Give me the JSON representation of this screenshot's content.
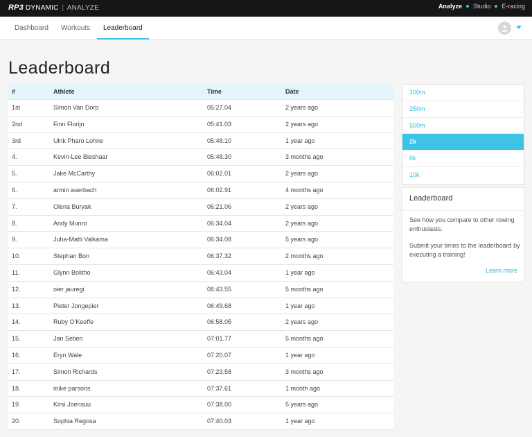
{
  "topbar": {
    "brand_logo": "RP3",
    "brand_name": "DYNAMIC",
    "brand_sep": "|",
    "brand_sub": "ANALYZE",
    "apps": [
      {
        "label": "Analyze",
        "active": true
      },
      {
        "label": "Studio",
        "active": false
      },
      {
        "label": "E-racing",
        "active": false
      }
    ]
  },
  "nav": {
    "tabs": [
      {
        "label": "Dashboard"
      },
      {
        "label": "Workouts"
      },
      {
        "label": "Leaderboard"
      }
    ]
  },
  "page": {
    "title": "Leaderboard"
  },
  "table": {
    "headers": {
      "rank": "#",
      "athlete": "Athlete",
      "time": "Time",
      "date": "Date"
    },
    "rows": [
      {
        "rank": "1st",
        "athlete": "Simon Van Dorp",
        "time": "05:27.04",
        "date": "2 years ago"
      },
      {
        "rank": "2nd",
        "athlete": "Finn Florijn",
        "time": "05:41.03",
        "date": "2 years ago"
      },
      {
        "rank": "3rd",
        "athlete": "Ulrik Pharo Lohne",
        "time": "05:48.10",
        "date": "1 year ago"
      },
      {
        "rank": "4.",
        "athlete": "Kevin-Lee Bieshaar",
        "time": "05:48.30",
        "date": "3 months ago"
      },
      {
        "rank": "5.",
        "athlete": "Jake McCarthy",
        "time": "06:02.01",
        "date": "2 years ago"
      },
      {
        "rank": "6.",
        "athlete": "armin auerbach",
        "time": "06:02.91",
        "date": "4 months ago"
      },
      {
        "rank": "7.",
        "athlete": "Olena Buryak",
        "time": "06:21.06",
        "date": "2 years ago"
      },
      {
        "rank": "8.",
        "athlete": "Andy Munro",
        "time": "06:34.04",
        "date": "2 years ago"
      },
      {
        "rank": "9.",
        "athlete": "Juha-Matti Valkama",
        "time": "06:34.08",
        "date": "5 years ago"
      },
      {
        "rank": "10.",
        "athlete": "Stephan Bon",
        "time": "06:37.32",
        "date": "2 months ago"
      },
      {
        "rank": "11.",
        "athlete": "Glynn Bolitho",
        "time": "06:43.04",
        "date": "1 year ago"
      },
      {
        "rank": "12.",
        "athlete": "oier jauregi",
        "time": "06:43.55",
        "date": "5 months ago"
      },
      {
        "rank": "13.",
        "athlete": "Pieter Jongepier",
        "time": "06:49.68",
        "date": "1 year ago"
      },
      {
        "rank": "14.",
        "athlete": "Ruby O'Keeffe",
        "time": "06:58.05",
        "date": "2 years ago"
      },
      {
        "rank": "15.",
        "athlete": "Jan Setien",
        "time": "07:01.77",
        "date": "5 months ago"
      },
      {
        "rank": "16.",
        "athlete": "Eryn Wale",
        "time": "07:20.07",
        "date": "1 year ago"
      },
      {
        "rank": "17.",
        "athlete": "Simon Richards",
        "time": "07:23.58",
        "date": "3 months ago"
      },
      {
        "rank": "18.",
        "athlete": "mike parsons",
        "time": "07:37.61",
        "date": "1 month ago"
      },
      {
        "rank": "19.",
        "athlete": "Kirsi Joensuu",
        "time": "07:38.00",
        "date": "5 years ago"
      },
      {
        "rank": "20.",
        "athlete": "Sophia Regosa",
        "time": "07:40.03",
        "date": "1 year ago"
      }
    ]
  },
  "distances": [
    {
      "label": "100m",
      "active": false
    },
    {
      "label": "250m",
      "active": false
    },
    {
      "label": "500m",
      "active": false
    },
    {
      "label": "2k",
      "active": true
    },
    {
      "label": "6k",
      "active": false
    },
    {
      "label": "10k",
      "active": false
    }
  ],
  "info": {
    "title": "Leaderboard",
    "p1": "See how you compare to other rowing enthusiasts.",
    "p2": "Submit your times to the leaderboard by executing a training!",
    "learn_more": "Learn more"
  },
  "colors": {
    "accent": "#3cc3e6",
    "topbar": "#161616",
    "header_bg": "#e3f6fb"
  },
  "icons": {
    "avatar": "user-avatar-icon",
    "menu": "chevron-down-icon"
  }
}
